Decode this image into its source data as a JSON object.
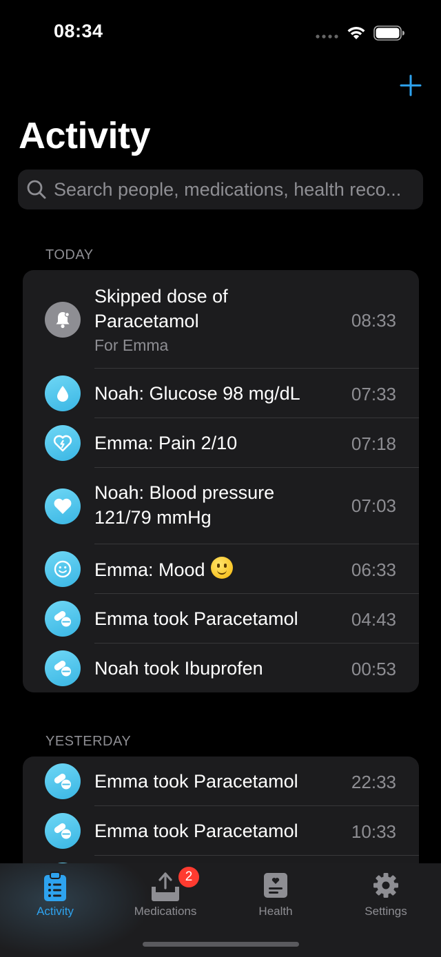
{
  "status_bar": {
    "time": "08:34"
  },
  "header": {
    "title": "Activity",
    "add_icon": "plus-icon"
  },
  "search": {
    "placeholder": "Search people, medications, health reco...",
    "value": ""
  },
  "sections": [
    {
      "title": "TODAY",
      "items": [
        {
          "icon": "bell-icon",
          "line1": "Skipped dose of",
          "line2": "Paracetamol",
          "subtitle": "For Emma",
          "time": "08:33"
        },
        {
          "icon": "drop-icon",
          "title": "Noah: Glucose 98 mg/dL",
          "time": "07:33"
        },
        {
          "icon": "broken-heart-icon",
          "title": "Emma: Pain 2/10",
          "time": "07:18"
        },
        {
          "icon": "heart-icon",
          "line1": "Noah: Blood pressure",
          "line2": "121/79 mmHg",
          "time": "07:03"
        },
        {
          "icon": "smiley-icon",
          "title": "Emma: Mood",
          "emoji": "slightly-smiling-face",
          "time": "06:33"
        },
        {
          "icon": "pills-icon",
          "title": "Emma took Paracetamol",
          "time": "04:43"
        },
        {
          "icon": "pills-icon",
          "title": "Noah took Ibuprofen",
          "time": "00:53"
        }
      ]
    },
    {
      "title": "YESTERDAY",
      "items": [
        {
          "icon": "pills-icon",
          "title": "Emma took Paracetamol",
          "time": "22:33"
        },
        {
          "icon": "pills-icon",
          "title": "Emma took Paracetamol",
          "time": "10:33"
        }
      ]
    }
  ],
  "tab_bar": {
    "tabs": [
      {
        "label": "Activity",
        "icon": "clipboard-list-icon",
        "active": true
      },
      {
        "label": "Medications",
        "icon": "tray-upload-icon",
        "badge": "2"
      },
      {
        "label": "Health",
        "icon": "health-record-icon"
      },
      {
        "label": "Settings",
        "icon": "gear-icon"
      }
    ]
  },
  "colors": {
    "accent": "#2ea3ef",
    "badge": "#ff3b30",
    "icon_gradient_top": "#6fd7f5",
    "icon_gradient_bottom": "#3ab6e4",
    "background": "#000000",
    "card": "#1c1c1e"
  }
}
